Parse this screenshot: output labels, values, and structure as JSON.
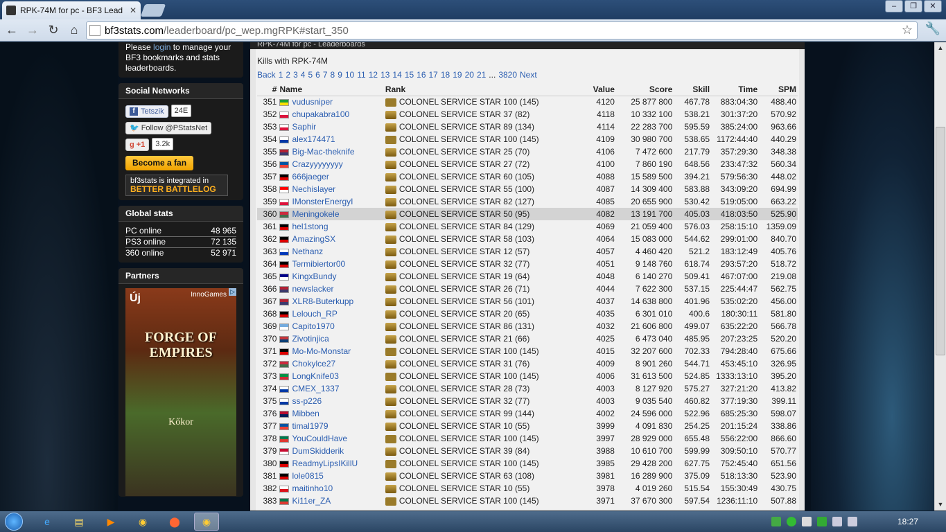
{
  "browser": {
    "tab_title": "RPK-74M for pc - BF3 Lead",
    "url_domain": "bf3stats.com",
    "url_path": "/leaderboard/pc_wep.mgRPK#start_350"
  },
  "sidebar": {
    "bookmarks_text_pre": "Please ",
    "bookmarks_login": "login",
    "bookmarks_text_post": " to manage your BF3 bookmarks and stats leaderboards.",
    "social_title": "Social Networks",
    "fb_label": "Tetszik",
    "fb_count": "24E",
    "twitter_label": "Follow @PStatsNet",
    "gplus_label": "+1",
    "gplus_count": "3.2k",
    "fan_label": "Become a fan",
    "bb_line1": "bf3stats is integrated in",
    "bb_line2": "BETTER BATTLELOG",
    "global_title": "Global stats",
    "global": [
      {
        "label": "PC online",
        "value": "48 965"
      },
      {
        "label": "PS3 online",
        "value": "72 135"
      },
      {
        "label": "360 online",
        "value": "52 971"
      }
    ],
    "partners_title": "Partners",
    "ad_uj": "Új",
    "ad_inno": "InnoGames",
    "ad_logo": "FORGE OF EMPIRES",
    "ad_kokor": "Kőkor"
  },
  "main": {
    "header": "RPK-74M for pc - Leaderboards",
    "kills_label": "Kills with RPK-74M",
    "pager": [
      "Back",
      "1",
      "2",
      "3",
      "4",
      "5",
      "6",
      "7",
      "8",
      "9",
      "10",
      "11",
      "12",
      "13",
      "14",
      "15",
      "16",
      "17",
      "18",
      "19",
      "20",
      "21",
      "...",
      "3820",
      "Next"
    ],
    "columns": [
      "#",
      "Name",
      "Rank",
      "Value",
      "Score",
      "Skill",
      "Time",
      "SPM"
    ],
    "rows": [
      {
        "n": "351",
        "flag": "br",
        "name": "vudusniper",
        "rank": "COLONEL SERVICE STAR 100 (145)",
        "value": "4120",
        "score": "25 877 800",
        "skill": "467.78",
        "time": "883:04:30",
        "spm": "488.40"
      },
      {
        "n": "352",
        "flag": "pl",
        "name": "chupakabra100",
        "rank": "COLONEL SERVICE STAR 37 (82)",
        "value": "4118",
        "score": "10 332 100",
        "skill": "538.21",
        "time": "301:37:20",
        "spm": "570.92"
      },
      {
        "n": "353",
        "flag": "pl",
        "name": "Saphir",
        "rank": "COLONEL SERVICE STAR 89 (134)",
        "value": "4114",
        "score": "22 283 700",
        "skill": "595.59",
        "time": "385:24:00",
        "spm": "963.66"
      },
      {
        "n": "354",
        "flag": "ru",
        "name": "alex174471",
        "rank": "COLONEL SERVICE STAR 100 (145)",
        "value": "4109",
        "score": "30 980 700",
        "skill": "538.65",
        "time": "1172:44:40",
        "spm": "440.29"
      },
      {
        "n": "355",
        "flag": "us",
        "name": "Big-Mac-theknife",
        "rank": "COLONEL SERVICE STAR 25 (70)",
        "value": "4106",
        "score": "7 472 600",
        "skill": "217.79",
        "time": "357:29:30",
        "spm": "348.38"
      },
      {
        "n": "356",
        "flag": "fr",
        "name": "Crazyyyyyyyy",
        "rank": "COLONEL SERVICE STAR 27 (72)",
        "value": "4100",
        "score": "7 860 190",
        "skill": "648.56",
        "time": "233:47:32",
        "spm": "560.34"
      },
      {
        "n": "357",
        "flag": "de",
        "name": "666jaeger",
        "rank": "COLONEL SERVICE STAR 60 (105)",
        "value": "4088",
        "score": "15 589 500",
        "skill": "394.21",
        "time": "579:56:30",
        "spm": "448.02"
      },
      {
        "n": "358",
        "flag": "ca",
        "name": "Nechislayer",
        "rank": "COLONEL SERVICE STAR 55 (100)",
        "value": "4087",
        "score": "14 309 400",
        "skill": "583.88",
        "time": "343:09:20",
        "spm": "694.99"
      },
      {
        "n": "359",
        "flag": "pl",
        "name": "IMonsterEnergyI",
        "rank": "COLONEL SERVICE STAR 82 (127)",
        "value": "4085",
        "score": "20 655 900",
        "skill": "530.42",
        "time": "519:05:00",
        "spm": "663.22"
      },
      {
        "n": "360",
        "flag": "hu",
        "name": "Meningokele",
        "rank": "COLONEL SERVICE STAR 50 (95)",
        "value": "4082",
        "score": "13 191 700",
        "skill": "405.03",
        "time": "418:03:50",
        "spm": "525.90",
        "hl": true
      },
      {
        "n": "361",
        "flag": "de",
        "name": "hel1stong",
        "rank": "COLONEL SERVICE STAR 84 (129)",
        "value": "4069",
        "score": "21 059 400",
        "skill": "576.03",
        "time": "258:15:10",
        "spm": "1359.09"
      },
      {
        "n": "362",
        "flag": "de",
        "name": "AmazingSX",
        "rank": "COLONEL SERVICE STAR 58 (103)",
        "value": "4064",
        "score": "15 083 000",
        "skill": "544.62",
        "time": "299:01:00",
        "spm": "840.70"
      },
      {
        "n": "363",
        "flag": "il",
        "name": "Nethanz",
        "rank": "COLONEL SERVICE STAR 12 (57)",
        "value": "4057",
        "score": "4 460 420",
        "skill": "521.2",
        "time": "183:12:49",
        "spm": "405.76"
      },
      {
        "n": "364",
        "flag": "de",
        "name": "Termibiertor00",
        "rank": "COLONEL SERVICE STAR 32 (77)",
        "value": "4051",
        "score": "9 148 760",
        "skill": "618.74",
        "time": "293:57:20",
        "spm": "518.72"
      },
      {
        "n": "365",
        "flag": "au",
        "name": "KingxBundy",
        "rank": "COLONEL SERVICE STAR 19 (64)",
        "value": "4048",
        "score": "6 140 270",
        "skill": "509.41",
        "time": "467:07:00",
        "spm": "219.08"
      },
      {
        "n": "366",
        "flag": "us",
        "name": "newslacker",
        "rank": "COLONEL SERVICE STAR 26 (71)",
        "value": "4044",
        "score": "7 622 300",
        "skill": "537.15",
        "time": "225:44:47",
        "spm": "562.75"
      },
      {
        "n": "367",
        "flag": "us",
        "name": "XLR8-Buterkupp",
        "rank": "COLONEL SERVICE STAR 56 (101)",
        "value": "4037",
        "score": "14 638 800",
        "skill": "401.96",
        "time": "535:02:20",
        "spm": "456.00"
      },
      {
        "n": "368",
        "flag": "de",
        "name": "Lelouch_RP",
        "rank": "COLONEL SERVICE STAR 20 (65)",
        "value": "4035",
        "score": "6 301 010",
        "skill": "400.6",
        "time": "180:30:11",
        "spm": "581.80"
      },
      {
        "n": "369",
        "flag": "ar",
        "name": "Capito1970",
        "rank": "COLONEL SERVICE STAR 86 (131)",
        "value": "4032",
        "score": "21 606 800",
        "skill": "499.07",
        "time": "635:22:20",
        "spm": "566.78"
      },
      {
        "n": "370",
        "flag": "rs",
        "name": "Zivotinjica",
        "rank": "COLONEL SERVICE STAR 21 (66)",
        "value": "4025",
        "score": "6 473 040",
        "skill": "485.95",
        "time": "207:23:25",
        "spm": "520.20"
      },
      {
        "n": "371",
        "flag": "de",
        "name": "Mo-Mo-Monstar",
        "rank": "COLONEL SERVICE STAR 100 (145)",
        "value": "4015",
        "score": "32 207 600",
        "skill": "702.33",
        "time": "794:28:40",
        "spm": "675.66"
      },
      {
        "n": "372",
        "flag": "hu",
        "name": "Chokylce27",
        "rank": "COLONEL SERVICE STAR 31 (76)",
        "value": "4009",
        "score": "8 901 260",
        "skill": "544.71",
        "time": "453:45:10",
        "spm": "326.95"
      },
      {
        "n": "373",
        "flag": "it",
        "name": "LongKnife03",
        "rank": "COLONEL SERVICE STAR 100 (145)",
        "value": "4006",
        "score": "31 613 500",
        "skill": "524.85",
        "time": "1333:13:10",
        "spm": "395.20"
      },
      {
        "n": "374",
        "flag": "ru",
        "name": "CMEX_1337",
        "rank": "COLONEL SERVICE STAR 28 (73)",
        "value": "4003",
        "score": "8 127 920",
        "skill": "575.27",
        "time": "327:21:20",
        "spm": "413.82"
      },
      {
        "n": "375",
        "flag": "ru",
        "name": "ss-p226",
        "rank": "COLONEL SERVICE STAR 32 (77)",
        "value": "4003",
        "score": "9 035 540",
        "skill": "460.82",
        "time": "377:19:30",
        "spm": "399.11"
      },
      {
        "n": "376",
        "flag": "no",
        "name": "Mibben",
        "rank": "COLONEL SERVICE STAR 99 (144)",
        "value": "4002",
        "score": "24 596 000",
        "skill": "522.96",
        "time": "685:25:30",
        "spm": "598.07"
      },
      {
        "n": "377",
        "flag": "fr",
        "name": "timal1979",
        "rank": "COLONEL SERVICE STAR 10 (55)",
        "value": "3999",
        "score": "4 091 830",
        "skill": "254.25",
        "time": "201:15:24",
        "spm": "338.86"
      },
      {
        "n": "378",
        "flag": "za",
        "name": "YouCouldHave",
        "rank": "COLONEL SERVICE STAR 100 (145)",
        "value": "3997",
        "score": "28 929 000",
        "skill": "655.48",
        "time": "556:22:00",
        "spm": "866.60"
      },
      {
        "n": "379",
        "flag": "dk",
        "name": "DumSkidderik",
        "rank": "COLONEL SERVICE STAR 39 (84)",
        "value": "3988",
        "score": "10 610 700",
        "skill": "599.99",
        "time": "309:50:10",
        "spm": "570.77"
      },
      {
        "n": "380",
        "flag": "de",
        "name": "ReadmyLipsIKillU",
        "rank": "COLONEL SERVICE STAR 100 (145)",
        "value": "3985",
        "score": "29 428 200",
        "skill": "627.75",
        "time": "752:45:40",
        "spm": "651.56"
      },
      {
        "n": "381",
        "flag": "de",
        "name": "lole0815",
        "rank": "COLONEL SERVICE STAR 63 (108)",
        "value": "3981",
        "score": "16 289 900",
        "skill": "375.09",
        "time": "518:13:30",
        "spm": "523.90"
      },
      {
        "n": "382",
        "flag": "pa",
        "name": "maitinho10",
        "rank": "COLONEL SERVICE STAR 10 (55)",
        "value": "3978",
        "score": "4 019 260",
        "skill": "515.54",
        "time": "155:30:49",
        "spm": "430.75"
      },
      {
        "n": "383",
        "flag": "za",
        "name": "Ki11er_ZA",
        "rank": "COLONEL SERVICE STAR 100 (145)",
        "value": "3971",
        "score": "37 670 300",
        "skill": "597.54",
        "time": "1236:11:10",
        "spm": "507.88"
      }
    ]
  },
  "flag_colors": {
    "br": [
      "#1b9e3a",
      "#ffdf00"
    ],
    "pl": [
      "#ffffff",
      "#dc143c"
    ],
    "ru": [
      "#ffffff",
      "#0039a6"
    ],
    "us": [
      "#b22234",
      "#3c3b6e"
    ],
    "fr": [
      "#0055a4",
      "#ef4135"
    ],
    "de": [
      "#000000",
      "#dd0000"
    ],
    "ca": [
      "#ff0000",
      "#ffffff"
    ],
    "hu": [
      "#cd2a3e",
      "#436f4d"
    ],
    "il": [
      "#ffffff",
      "#0038b8"
    ],
    "au": [
      "#00008b",
      "#ffffff"
    ],
    "ar": [
      "#74acdf",
      "#ffffff"
    ],
    "rs": [
      "#c6363c",
      "#0c4076"
    ],
    "it": [
      "#009246",
      "#ce2b37"
    ],
    "no": [
      "#ba0c2f",
      "#00205b"
    ],
    "za": [
      "#007a4d",
      "#de3831"
    ],
    "dk": [
      "#c60c30",
      "#ffffff"
    ],
    "pa": [
      "#ffffff",
      "#da121a"
    ]
  },
  "taskbar": {
    "clock": "18:27"
  }
}
